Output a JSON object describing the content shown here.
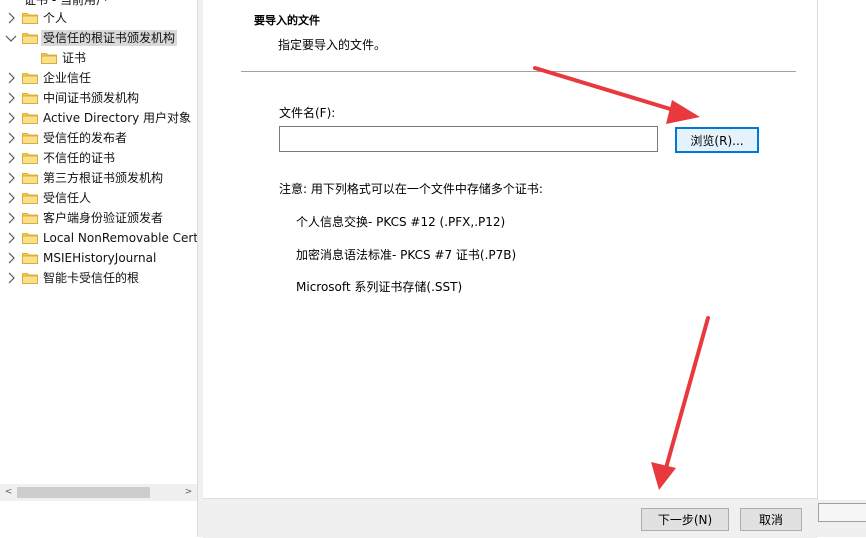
{
  "tree": {
    "cutoff_text": "证书 - 当前用户",
    "items": [
      {
        "label": "个人",
        "expanded": false,
        "indent": 0,
        "has_chevron": true
      },
      {
        "label": "受信任的根证书颁发机构",
        "expanded": true,
        "indent": 0,
        "has_chevron": true,
        "selected": true
      },
      {
        "label": "证书",
        "expanded": false,
        "indent": 1,
        "has_chevron": false
      },
      {
        "label": "企业信任",
        "expanded": false,
        "indent": 0,
        "has_chevron": true
      },
      {
        "label": "中间证书颁发机构",
        "expanded": false,
        "indent": 0,
        "has_chevron": true
      },
      {
        "label": "Active Directory 用户对象",
        "expanded": false,
        "indent": 0,
        "has_chevron": true
      },
      {
        "label": "受信任的发布者",
        "expanded": false,
        "indent": 0,
        "has_chevron": true
      },
      {
        "label": "不信任的证书",
        "expanded": false,
        "indent": 0,
        "has_chevron": true
      },
      {
        "label": "第三方根证书颁发机构",
        "expanded": false,
        "indent": 0,
        "has_chevron": true
      },
      {
        "label": "受信任人",
        "expanded": false,
        "indent": 0,
        "has_chevron": true
      },
      {
        "label": "客户端身份验证颁发者",
        "expanded": false,
        "indent": 0,
        "has_chevron": true
      },
      {
        "label": "Local NonRemovable Certificates",
        "expanded": false,
        "indent": 0,
        "has_chevron": true
      },
      {
        "label": "MSIEHistoryJournal",
        "expanded": false,
        "indent": 0,
        "has_chevron": true
      },
      {
        "label": "智能卡受信任的根",
        "expanded": false,
        "indent": 0,
        "has_chevron": true
      }
    ],
    "scroll_left_glyph": "<",
    "scroll_right_glyph": ">"
  },
  "wizard": {
    "section_title": "要导入的文件",
    "section_desc": "指定要导入的文件。",
    "file_label": "文件名(F):",
    "file_value": "",
    "browse_label": "浏览(R)...",
    "note": "注意: 用下列格式可以在一个文件中存储多个证书:",
    "formats": [
      "个人信息交换- PKCS #12 (.PFX,.P12)",
      "加密消息语法标准- PKCS #7 证书(.P7B)",
      "Microsoft 系列证书存储(.SST)"
    ],
    "next_label": "下一步(N)",
    "cancel_label": "取消"
  },
  "colors": {
    "accent": "#0078d7",
    "arrow": "#e8393f",
    "folder": "#f5c94a"
  },
  "icons": {
    "folder": "folder-icon",
    "chevron_right": "chevron-right-icon",
    "chevron_down": "chevron-down-icon"
  }
}
